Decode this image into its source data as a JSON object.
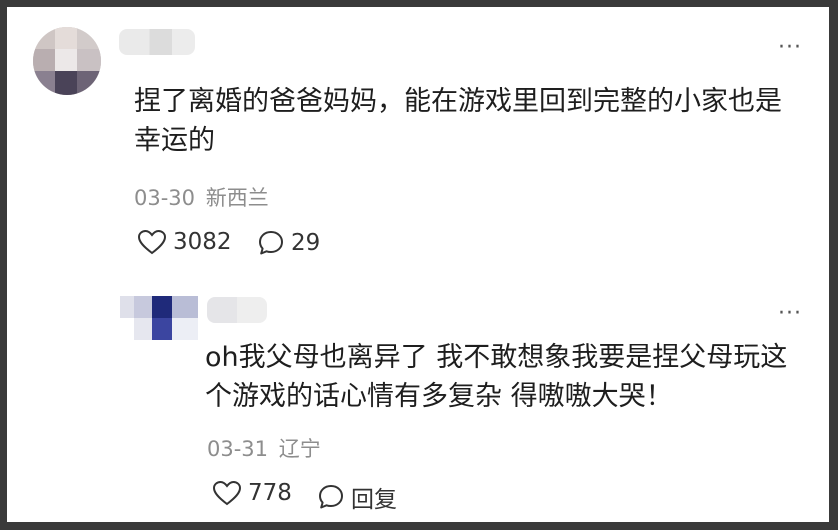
{
  "comments": [
    {
      "text": "捏了离婚的爸爸妈妈，能在游戏里回到完整的小家也是\n幸运的",
      "date": "03-30",
      "location": "新西兰",
      "likes": "3082",
      "replies": "29"
    },
    {
      "text": "oh我父母也离异了 我不敢想象我要是捏父母玩这\n个游戏的话心情有多复杂 得嗷嗷大哭！",
      "date": "03-31",
      "location": "辽宁",
      "likes": "778",
      "reply_label": "回复"
    }
  ],
  "more_glyph": "···",
  "icons": {
    "like": "heart-outline-icon",
    "comment": "speech-bubble-icon",
    "more": "more-dots-icon"
  },
  "colors": {
    "frame": "#3a3a3a",
    "text": "#1e1e1e",
    "meta": "#8d8d8d"
  }
}
